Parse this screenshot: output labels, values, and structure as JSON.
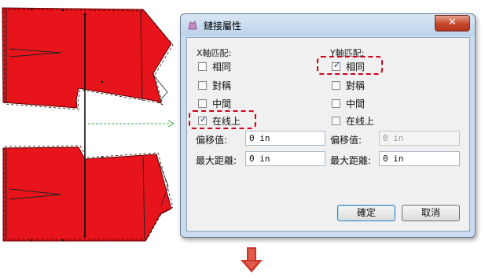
{
  "dialog": {
    "title": "鏈接屬性",
    "close_glyph": "✕",
    "x_axis": {
      "label": "X軸匹配:",
      "options": [
        {
          "label": "相同",
          "checked": false
        },
        {
          "label": "對稱",
          "checked": false
        },
        {
          "label": "中間",
          "checked": false
        },
        {
          "label": "在线上",
          "checked": true
        }
      ],
      "offset_label": "偏移值:",
      "offset_value": "0 in",
      "maxdist_label": "最大距離:",
      "maxdist_value": "0 in"
    },
    "y_axis": {
      "label": "Y軸匹配:",
      "options": [
        {
          "label": "相同",
          "checked": true
        },
        {
          "label": "對稱",
          "checked": false
        },
        {
          "label": "中間",
          "checked": false
        },
        {
          "label": "在线上",
          "checked": false
        }
      ],
      "offset_label": "偏移值:",
      "offset_value": "0 in",
      "offset_disabled": true,
      "maxdist_label": "最大距離:",
      "maxdist_value": "0 in"
    },
    "ok_label": "確定",
    "cancel_label": "取消"
  },
  "colors": {
    "pattern_fill": "#e8141b",
    "highlight": "#d0021b",
    "arrow": "#c8382a",
    "connector": "#28a745"
  },
  "icons": {
    "window": "pattern-icon",
    "close": "close-icon",
    "down_arrow": "down-arrow-icon"
  }
}
